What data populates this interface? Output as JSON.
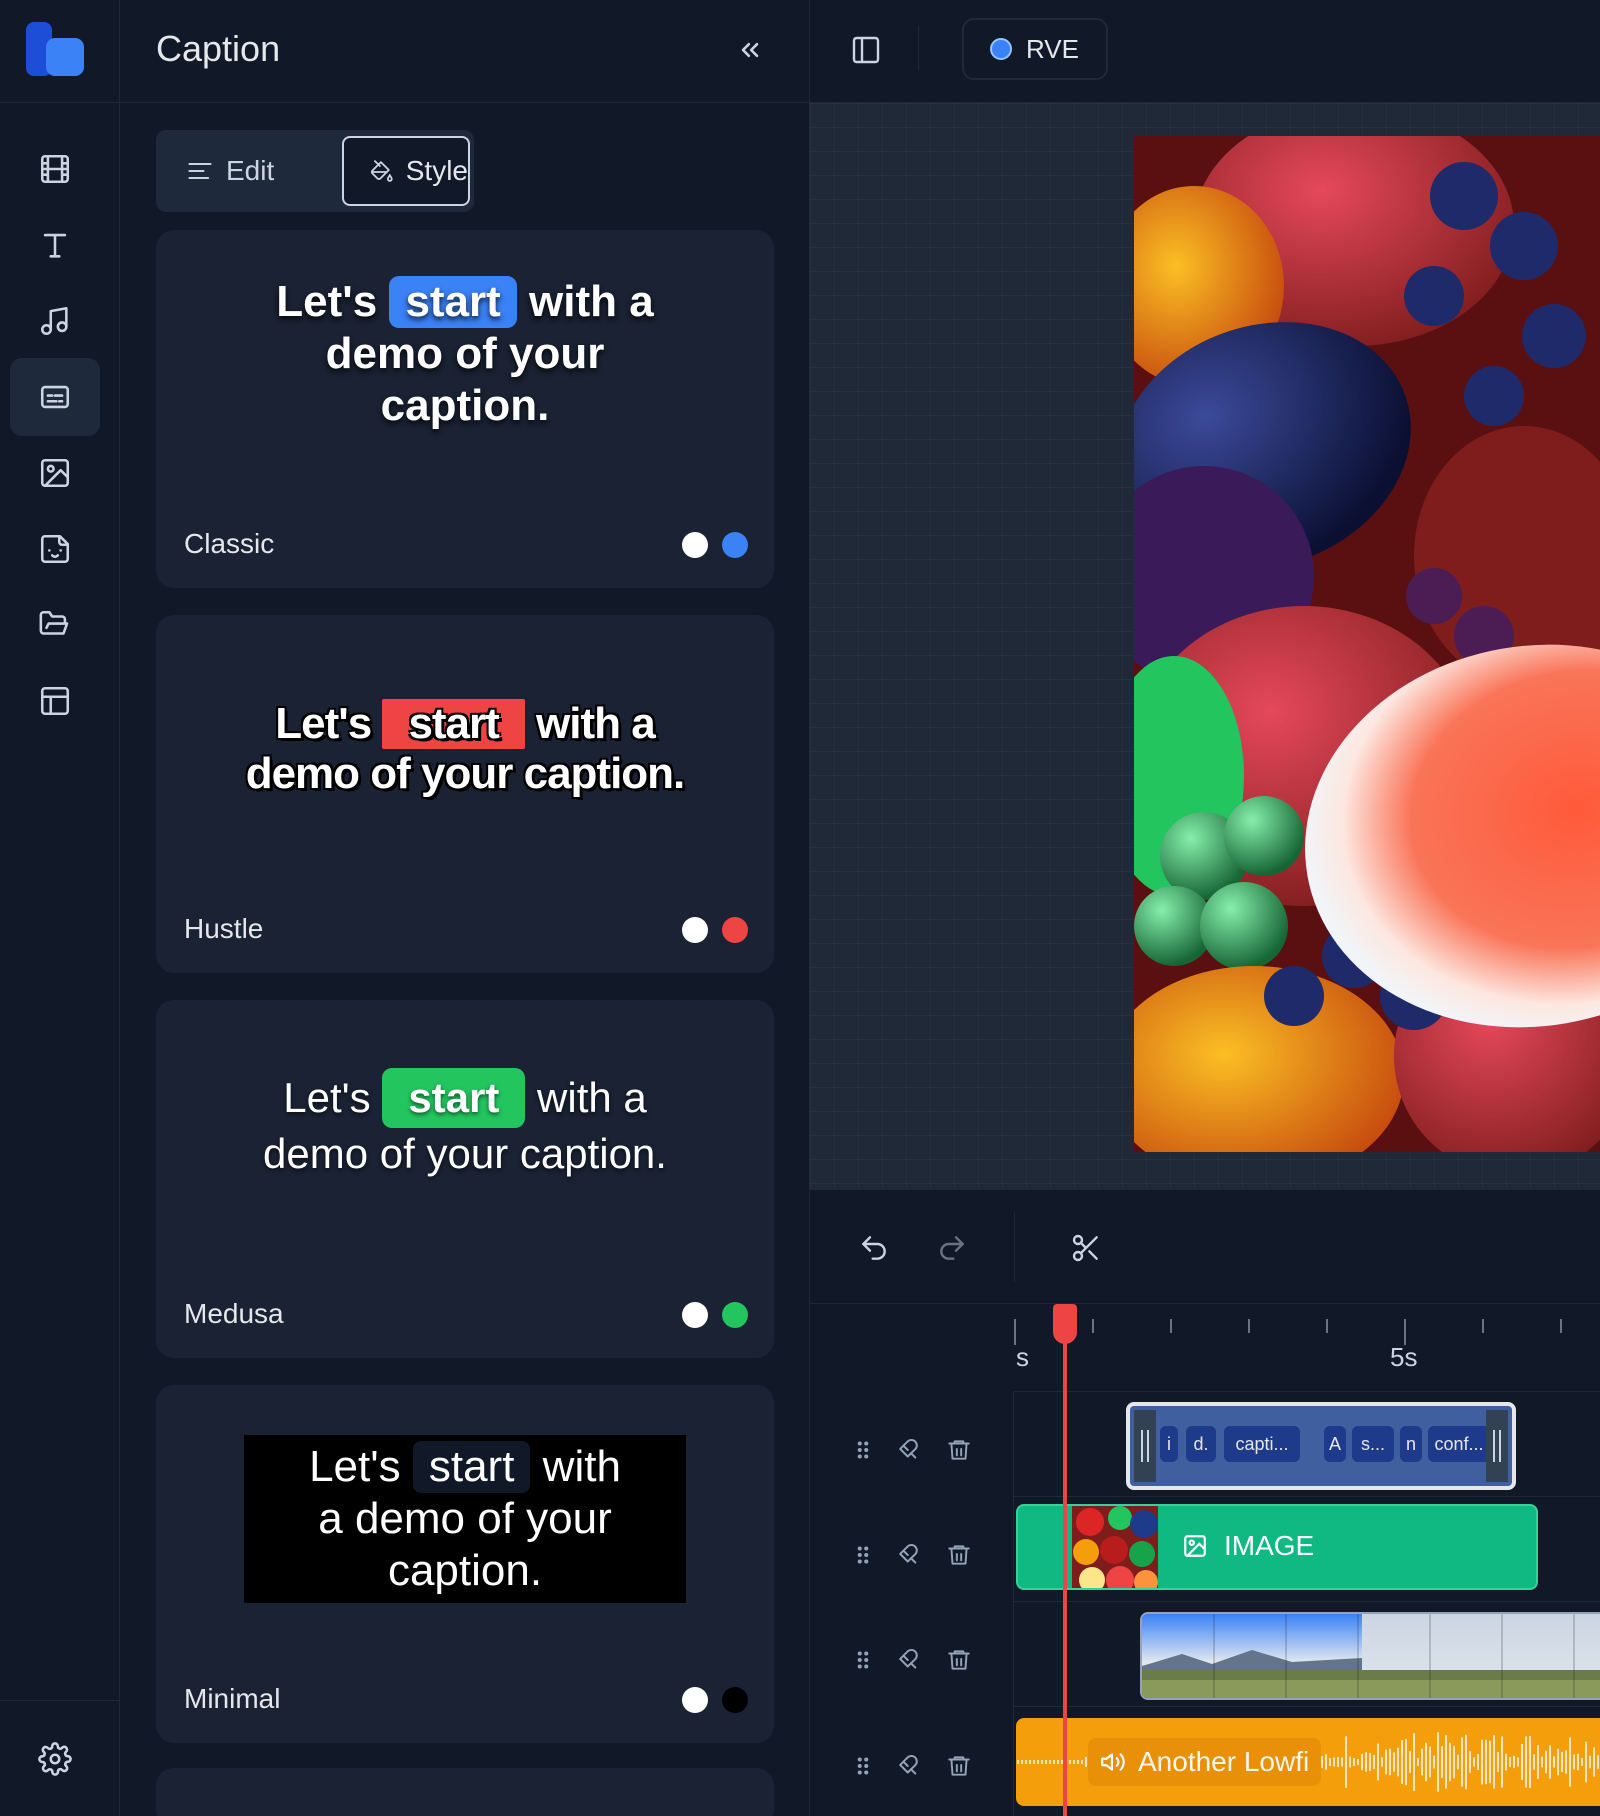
{
  "panel": {
    "title": "Caption",
    "tabs": {
      "edit": "Edit",
      "style": "Style"
    },
    "styles": [
      {
        "name": "Classic",
        "highlight_color": "#3b82f6",
        "text_color": "#ffffff",
        "before": "Let's ",
        "highlight": "start",
        "after": " with a",
        "line2": "demo of your",
        "line3": "caption."
      },
      {
        "name": "Hustle",
        "highlight_color": "#ef4444",
        "text_color": "#ffffff",
        "before": "Let's ",
        "highlight": "start",
        "after": " with a",
        "line2": "demo of your caption."
      },
      {
        "name": "Medusa",
        "highlight_color": "#22c55e",
        "text_color": "#ffffff",
        "before": "Let's ",
        "highlight": "start",
        "after": " with a",
        "line2": "demo of your caption."
      },
      {
        "name": "Minimal",
        "highlight_color": "#000000",
        "text_color": "#ffffff",
        "before": "Let's ",
        "highlight": "start",
        "after": " with",
        "line2": "a demo of your",
        "line3": "caption."
      }
    ]
  },
  "topbar": {
    "project_button": "RVE",
    "project_color": "#3b82f6"
  },
  "timeline": {
    "ruler_labels": [
      "s",
      "5s"
    ],
    "caption_segments": [
      "i",
      "d.",
      "capti...",
      "A",
      "s...",
      "n",
      "conf..."
    ],
    "image_clip_label": "IMAGE",
    "audio_clip_label": "Another Lowfi"
  },
  "icons": {
    "rail": [
      "film-icon",
      "text-icon",
      "music-icon",
      "captions-icon",
      "image-icon",
      "sticker-icon",
      "folder-icon",
      "layout-icon"
    ],
    "rail_bottom": "settings-icon",
    "active_rail_item": "captions-icon"
  },
  "colors": {
    "accent": "#3b82f6",
    "image_clip": "#10b981",
    "audio_clip": "#f59e0b",
    "playhead": "#ef4444",
    "caption_clip": "#3f5f9e"
  }
}
